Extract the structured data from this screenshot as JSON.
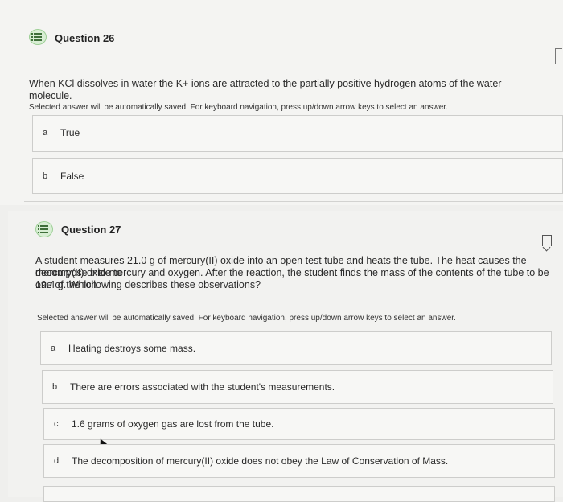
{
  "q26": {
    "title": "Question 26",
    "text": "When KCl dissolves in water the K+ ions are attracted to the partially positive hydrogen atoms of the water molecule.",
    "hint": "Selected answer will be automatically saved. For keyboard navigation, press up/down arrow keys to select an answer.",
    "options": [
      {
        "letter": "a",
        "label": "True"
      },
      {
        "letter": "b",
        "label": "False"
      }
    ]
  },
  "q27": {
    "title": "Question 27",
    "text_lines": [
      "A student measures 21.0 g of mercury(II) oxide into an open test tube and heats the tube. The heat causes the mercury(II) oxide to",
      "decompose into mercury and oxygen. After the reaction, the student finds the mass of the contents of the tube to be 19.4 g. Which",
      "one of the following describes these observations?"
    ],
    "hint": "Selected answer will be automatically saved. For keyboard navigation, press up/down arrow keys to select an answer.",
    "options": [
      {
        "letter": "a",
        "label": "Heating destroys some mass."
      },
      {
        "letter": "b",
        "label": "There are errors associated with the student's measurements."
      },
      {
        "letter": "c",
        "label": "1.6 grams of oxygen gas are lost from the tube."
      },
      {
        "letter": "d",
        "label": "The decomposition of mercury(II) oxide does not obey the Law of Conservation of Mass."
      }
    ]
  },
  "icons": [
    "question-list-icon",
    "bookmark-icon",
    "pointer-cursor-icon"
  ]
}
